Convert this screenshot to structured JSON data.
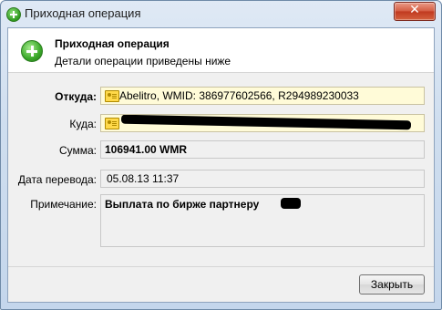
{
  "window": {
    "title": "Приходная операция",
    "close_symbol": "✕"
  },
  "header": {
    "title": "Приходная операция",
    "subtitle": "Детали операции приведены ниже",
    "icon": "plus-circle-icon"
  },
  "form": {
    "from": {
      "label": "Откуда:",
      "value": "Abelitro, WMID: 386977602566, R294989230033",
      "icon": "wmid-card-icon"
    },
    "to": {
      "label": "Куда:",
      "value": "",
      "icon": "wmid-card-icon"
    },
    "amount": {
      "label": "Сумма:",
      "value": "106941.00 WMR"
    },
    "date": {
      "label": "Дата перевода:",
      "value": "05.08.13 11:37"
    },
    "note": {
      "label": "Примечание:",
      "value": "Выплата по бирже партнеру"
    }
  },
  "footer": {
    "close_label": "Закрыть"
  }
}
